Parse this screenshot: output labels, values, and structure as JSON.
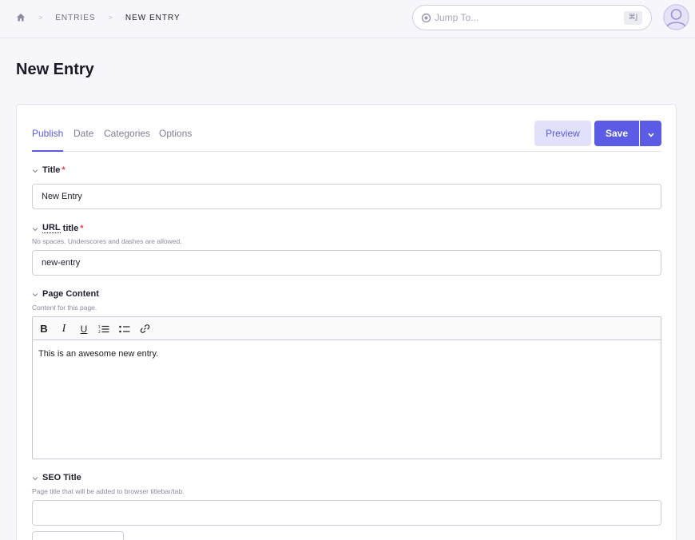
{
  "breadcrumb": {
    "home_icon": "home-icon",
    "separator": ">",
    "items": [
      "Entries",
      "New Entry"
    ]
  },
  "jump": {
    "placeholder": "Jump To...",
    "shortcut": "⌘J",
    "icon": "target-icon"
  },
  "user": {
    "avatar_icon": "user-avatar-icon"
  },
  "page": {
    "title": "New Entry"
  },
  "tabs": [
    {
      "label": "Publish",
      "active": true
    },
    {
      "label": "Date",
      "active": false
    },
    {
      "label": "Categories",
      "active": false
    },
    {
      "label": "Options",
      "active": false
    }
  ],
  "actions": {
    "preview_label": "Preview",
    "save_label": "Save"
  },
  "fields": {
    "title": {
      "label": "Title",
      "required": "*",
      "value": "New Entry"
    },
    "url_title": {
      "label_abbr": "URL",
      "label_rest": " title",
      "required": "*",
      "description": "No spaces. Underscores and dashes are allowed.",
      "value": "new-entry"
    },
    "page_content": {
      "label": "Page Content",
      "description": "Content for this page.",
      "value": "This is an awesome new entry."
    },
    "seo_title": {
      "label": "SEO Title",
      "description": "Page title that will be added to browser titlebar/tab.",
      "value": ""
    }
  },
  "colors": {
    "accent": "#5b5be6",
    "accent_light": "#e1e1fb",
    "required": "#e8424f"
  }
}
